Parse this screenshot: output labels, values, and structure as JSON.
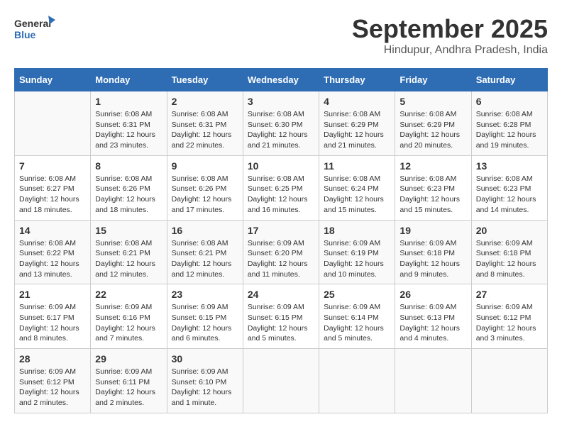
{
  "logo": {
    "general": "General",
    "blue": "Blue"
  },
  "title": "September 2025",
  "location": "Hindupur, Andhra Pradesh, India",
  "days_of_week": [
    "Sunday",
    "Monday",
    "Tuesday",
    "Wednesday",
    "Thursday",
    "Friday",
    "Saturday"
  ],
  "weeks": [
    [
      {
        "day": "",
        "info": ""
      },
      {
        "day": "1",
        "info": "Sunrise: 6:08 AM\nSunset: 6:31 PM\nDaylight: 12 hours\nand 23 minutes."
      },
      {
        "day": "2",
        "info": "Sunrise: 6:08 AM\nSunset: 6:31 PM\nDaylight: 12 hours\nand 22 minutes."
      },
      {
        "day": "3",
        "info": "Sunrise: 6:08 AM\nSunset: 6:30 PM\nDaylight: 12 hours\nand 21 minutes."
      },
      {
        "day": "4",
        "info": "Sunrise: 6:08 AM\nSunset: 6:29 PM\nDaylight: 12 hours\nand 21 minutes."
      },
      {
        "day": "5",
        "info": "Sunrise: 6:08 AM\nSunset: 6:29 PM\nDaylight: 12 hours\nand 20 minutes."
      },
      {
        "day": "6",
        "info": "Sunrise: 6:08 AM\nSunset: 6:28 PM\nDaylight: 12 hours\nand 19 minutes."
      }
    ],
    [
      {
        "day": "7",
        "info": "Sunrise: 6:08 AM\nSunset: 6:27 PM\nDaylight: 12 hours\nand 18 minutes."
      },
      {
        "day": "8",
        "info": "Sunrise: 6:08 AM\nSunset: 6:26 PM\nDaylight: 12 hours\nand 18 minutes."
      },
      {
        "day": "9",
        "info": "Sunrise: 6:08 AM\nSunset: 6:26 PM\nDaylight: 12 hours\nand 17 minutes."
      },
      {
        "day": "10",
        "info": "Sunrise: 6:08 AM\nSunset: 6:25 PM\nDaylight: 12 hours\nand 16 minutes."
      },
      {
        "day": "11",
        "info": "Sunrise: 6:08 AM\nSunset: 6:24 PM\nDaylight: 12 hours\nand 15 minutes."
      },
      {
        "day": "12",
        "info": "Sunrise: 6:08 AM\nSunset: 6:23 PM\nDaylight: 12 hours\nand 15 minutes."
      },
      {
        "day": "13",
        "info": "Sunrise: 6:08 AM\nSunset: 6:23 PM\nDaylight: 12 hours\nand 14 minutes."
      }
    ],
    [
      {
        "day": "14",
        "info": "Sunrise: 6:08 AM\nSunset: 6:22 PM\nDaylight: 12 hours\nand 13 minutes."
      },
      {
        "day": "15",
        "info": "Sunrise: 6:08 AM\nSunset: 6:21 PM\nDaylight: 12 hours\nand 12 minutes."
      },
      {
        "day": "16",
        "info": "Sunrise: 6:08 AM\nSunset: 6:21 PM\nDaylight: 12 hours\nand 12 minutes."
      },
      {
        "day": "17",
        "info": "Sunrise: 6:09 AM\nSunset: 6:20 PM\nDaylight: 12 hours\nand 11 minutes."
      },
      {
        "day": "18",
        "info": "Sunrise: 6:09 AM\nSunset: 6:19 PM\nDaylight: 12 hours\nand 10 minutes."
      },
      {
        "day": "19",
        "info": "Sunrise: 6:09 AM\nSunset: 6:18 PM\nDaylight: 12 hours\nand 9 minutes."
      },
      {
        "day": "20",
        "info": "Sunrise: 6:09 AM\nSunset: 6:18 PM\nDaylight: 12 hours\nand 8 minutes."
      }
    ],
    [
      {
        "day": "21",
        "info": "Sunrise: 6:09 AM\nSunset: 6:17 PM\nDaylight: 12 hours\nand 8 minutes."
      },
      {
        "day": "22",
        "info": "Sunrise: 6:09 AM\nSunset: 6:16 PM\nDaylight: 12 hours\nand 7 minutes."
      },
      {
        "day": "23",
        "info": "Sunrise: 6:09 AM\nSunset: 6:15 PM\nDaylight: 12 hours\nand 6 minutes."
      },
      {
        "day": "24",
        "info": "Sunrise: 6:09 AM\nSunset: 6:15 PM\nDaylight: 12 hours\nand 5 minutes."
      },
      {
        "day": "25",
        "info": "Sunrise: 6:09 AM\nSunset: 6:14 PM\nDaylight: 12 hours\nand 5 minutes."
      },
      {
        "day": "26",
        "info": "Sunrise: 6:09 AM\nSunset: 6:13 PM\nDaylight: 12 hours\nand 4 minutes."
      },
      {
        "day": "27",
        "info": "Sunrise: 6:09 AM\nSunset: 6:12 PM\nDaylight: 12 hours\nand 3 minutes."
      }
    ],
    [
      {
        "day": "28",
        "info": "Sunrise: 6:09 AM\nSunset: 6:12 PM\nDaylight: 12 hours\nand 2 minutes."
      },
      {
        "day": "29",
        "info": "Sunrise: 6:09 AM\nSunset: 6:11 PM\nDaylight: 12 hours\nand 2 minutes."
      },
      {
        "day": "30",
        "info": "Sunrise: 6:09 AM\nSunset: 6:10 PM\nDaylight: 12 hours\nand 1 minute."
      },
      {
        "day": "",
        "info": ""
      },
      {
        "day": "",
        "info": ""
      },
      {
        "day": "",
        "info": ""
      },
      {
        "day": "",
        "info": ""
      }
    ]
  ]
}
